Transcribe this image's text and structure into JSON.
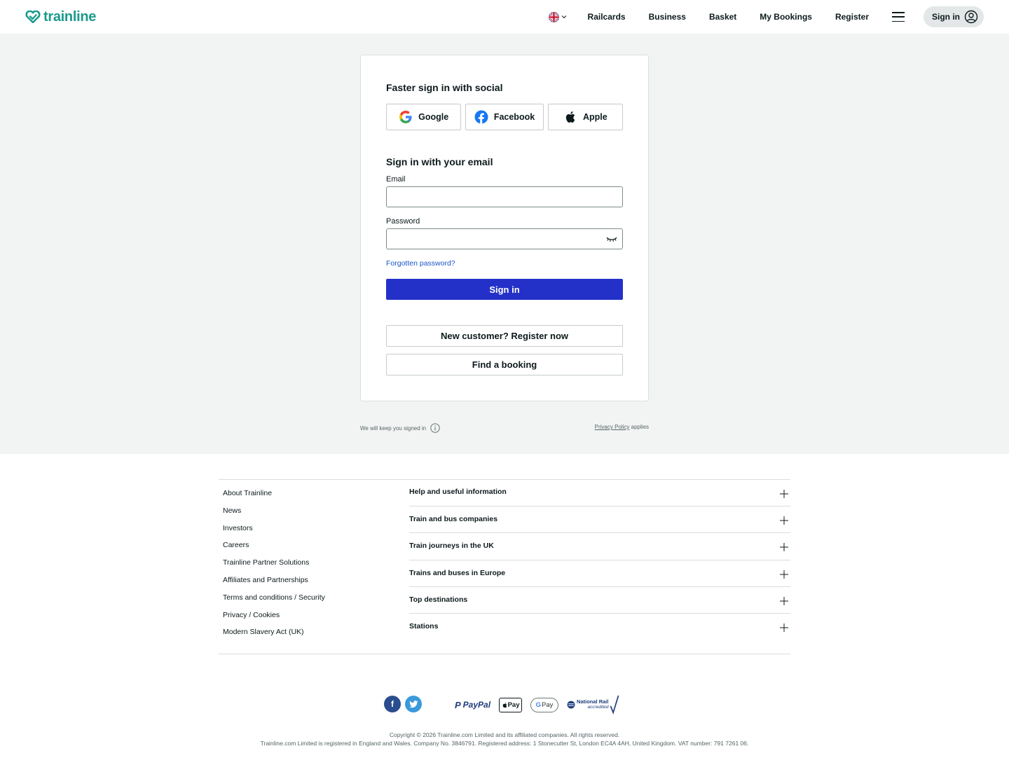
{
  "header": {
    "logo_text": "trainline",
    "nav": [
      "Railcards",
      "Business",
      "Basket",
      "My Bookings",
      "Register"
    ],
    "signin_label": "Sign in"
  },
  "signin_card": {
    "social_heading": "Faster sign in with social",
    "social_buttons": [
      "Google",
      "Facebook",
      "Apple"
    ],
    "email_heading": "Sign in with your email",
    "email_label": "Email",
    "email_value": "",
    "password_label": "Password",
    "password_value": "",
    "forgot_label": "Forgotten password?",
    "signin_button": "Sign in",
    "register_button": "New customer? Register now",
    "find_booking_button": "Find a booking"
  },
  "below_card": {
    "keep_signed_in": "We will keep you signed in",
    "privacy_link": "Privacy Policy",
    "privacy_suffix": " applies"
  },
  "footer": {
    "links": [
      "About Trainline",
      "News",
      "Investors",
      "Careers",
      "Trainline Partner Solutions",
      "Affiliates and Partnerships",
      "Terms and conditions / Security",
      "Privacy / Cookies",
      "Modern Slavery Act (UK)"
    ],
    "accordion": [
      "Help and useful information",
      "Train and bus companies",
      "Train journeys in the UK",
      "Trains and buses in Europe",
      "Top destinations",
      "Stations"
    ],
    "paypal": "PayPal",
    "apple_pay": "Pay",
    "google_pay": "Pay",
    "national_rail": "National Rail",
    "national_rail_sub": "accredited",
    "copyright": "Copyright © 2026 Trainline.com Limited and its affiliated companies. All rights reserved.",
    "registration": "Trainline.com Limited is registered in England and Wales. Company No. 3846791. Registered address: 1 Stonecutter St, London EC4A 4AH, United Kingdom. VAT number: 791 7261 06."
  },
  "colors": {
    "brand": "#1a9a8c",
    "primary_button": "#2431c8",
    "link": "#1a55c8",
    "page_bg": "#f2f4f3"
  }
}
